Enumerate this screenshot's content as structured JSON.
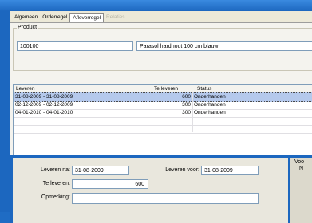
{
  "tabs": [
    {
      "label": "Algemeen"
    },
    {
      "label": "Orderregel"
    },
    {
      "label": "Afleverregel"
    },
    {
      "label": "Relaties"
    }
  ],
  "product": {
    "group_label": "Product",
    "code": "100100",
    "description": "Parasol hardhout 100 cm blauw"
  },
  "grid": {
    "columns": [
      "Leveren",
      "Te leveren",
      "Status"
    ],
    "rows": [
      {
        "period": "31-08-2009 - 31-08-2009",
        "amount": "600",
        "status": "Onderhanden"
      },
      {
        "period": "02-12-2009 - 02-12-2009",
        "amount": "300",
        "status": "Onderhanden"
      },
      {
        "period": "04-01-2010 - 04-01-2010",
        "amount": "300",
        "status": "Onderhanden"
      }
    ]
  },
  "form": {
    "leveren_na_label": "Leveren na:",
    "leveren_na_value": "31-08-2009",
    "leveren_voor_label": "Leveren voor:",
    "leveren_voor_value": "31-08-2009",
    "te_leveren_label": "Te leveren:",
    "te_leveren_value": "600",
    "opmerking_label": "Opmerking:",
    "side_label_top": "Voo",
    "side_label_mid": "N"
  }
}
